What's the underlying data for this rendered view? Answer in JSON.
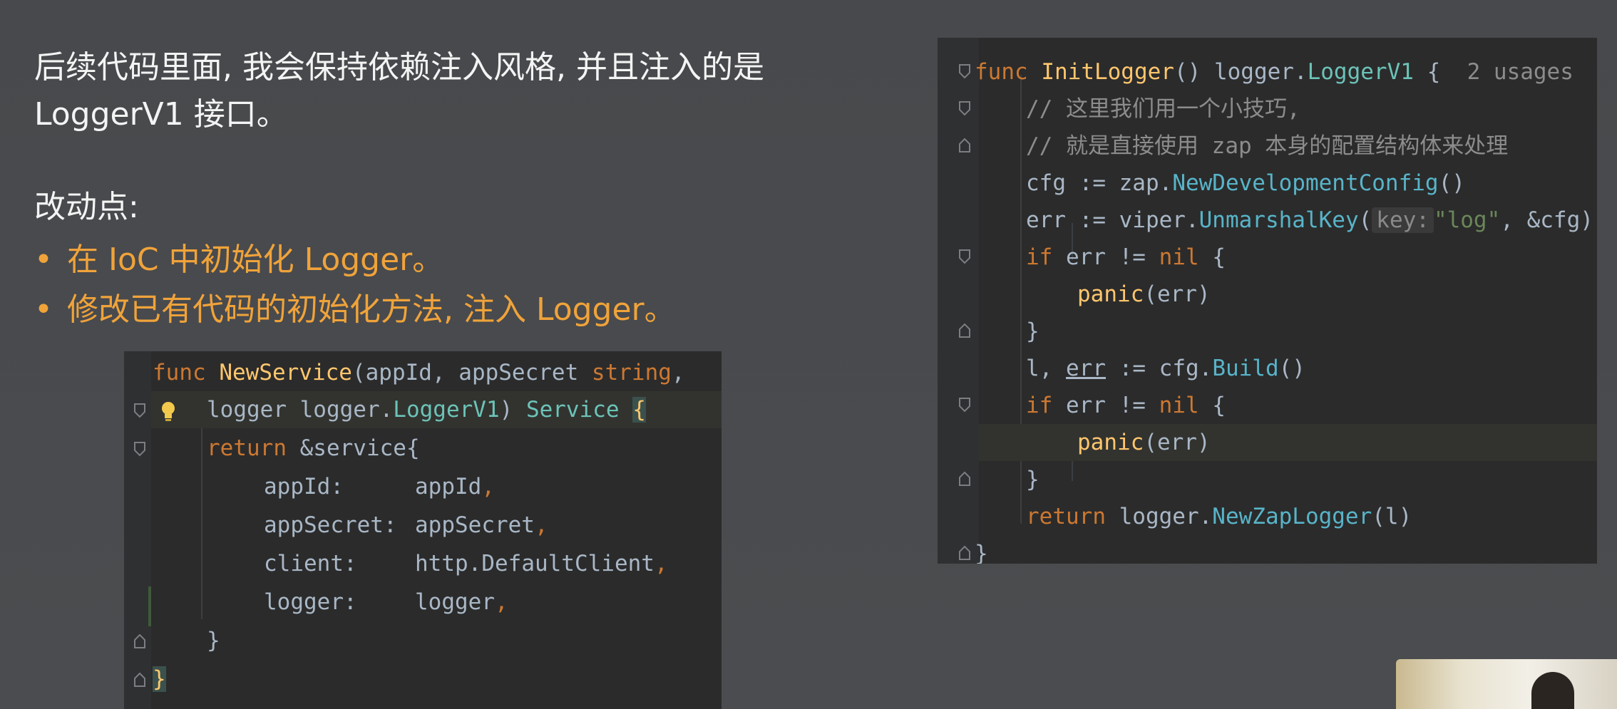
{
  "slide": {
    "intro_line1": "后续代码里面, 我会保持依赖注入风格, 并且注入的是",
    "intro_line2": "LoggerV1 接口。",
    "changes_title": "改动点:",
    "bullets": [
      "在 IoC 中初始化 Logger。",
      "修改已有代码的初始化方法, 注入 Logger。"
    ],
    "bullet_symbol": "•"
  },
  "colors": {
    "background": "#48494c",
    "accent_orange": "#f0a33a",
    "editor_bg": "#2b2b2b"
  },
  "code_right": {
    "l1_kw": "func ",
    "l1_fn": "InitLogger",
    "l1_rest": "() logger.",
    "l1_type": "LoggerV1",
    "l1_brace": " {",
    "l1_usages": "2 usages",
    "l1_trail": "no",
    "l2_comment": "// 这里我们用一个小技巧,",
    "l3_comment": "// 就是直接使用 zap 本身的配置结构体来处理",
    "l4_var": "cfg := zap.",
    "l4_call": "NewDevelopmentConfig",
    "l4_end": "()",
    "l5_var": "err := viper.",
    "l5_call": "UnmarshalKey",
    "l5_paren": "(",
    "l5_hint": "key:",
    "l5_str": "\"log\"",
    "l5_end": ", &cfg)",
    "l6_kw": "if",
    "l6_mid": " err != ",
    "l6_nil": "nil",
    "l6_end": " {",
    "l7_panic": "panic",
    "l7_end": "(err)",
    "l8": "}",
    "l9_a": "l, ",
    "l9_err": "err",
    "l9_b": " := cfg.",
    "l9_call": "Build",
    "l9_end": "()",
    "l10_kw": "if",
    "l10_mid": " err != ",
    "l10_nil": "nil",
    "l10_end": " {",
    "l11_panic": "panic",
    "l11_end": "(err)",
    "l12": "}",
    "l13_kw": "return",
    "l13_mid": " logger.",
    "l13_call": "NewZapLogger",
    "l13_end": "(l)",
    "l14": "}"
  },
  "code_left": {
    "l1_kw": "func ",
    "l1_fn": "NewService",
    "l1_rest": "(appId, appSecret ",
    "l1_type": "string",
    "l1_end": ",",
    "l2_a": "logger logger.",
    "l2_type": "LoggerV1",
    "l2_b": ") ",
    "l2_svc": "Service",
    "l2_brace": "{",
    "l3_kw": "return",
    "l3_rest": " &service{",
    "l4_key": "appId:",
    "l4_val": "appId",
    "l4_comma": ",",
    "l5_key": "appSecret:",
    "l5_val": "appSecret",
    "l5_comma": ",",
    "l6_key": "client:",
    "l6_pkg": "http.",
    "l6_val": "DefaultClient",
    "l6_comma": ",",
    "l7_key": "logger:",
    "l7_val": "logger",
    "l7_comma": ",",
    "l8": "}",
    "l9": "}"
  }
}
